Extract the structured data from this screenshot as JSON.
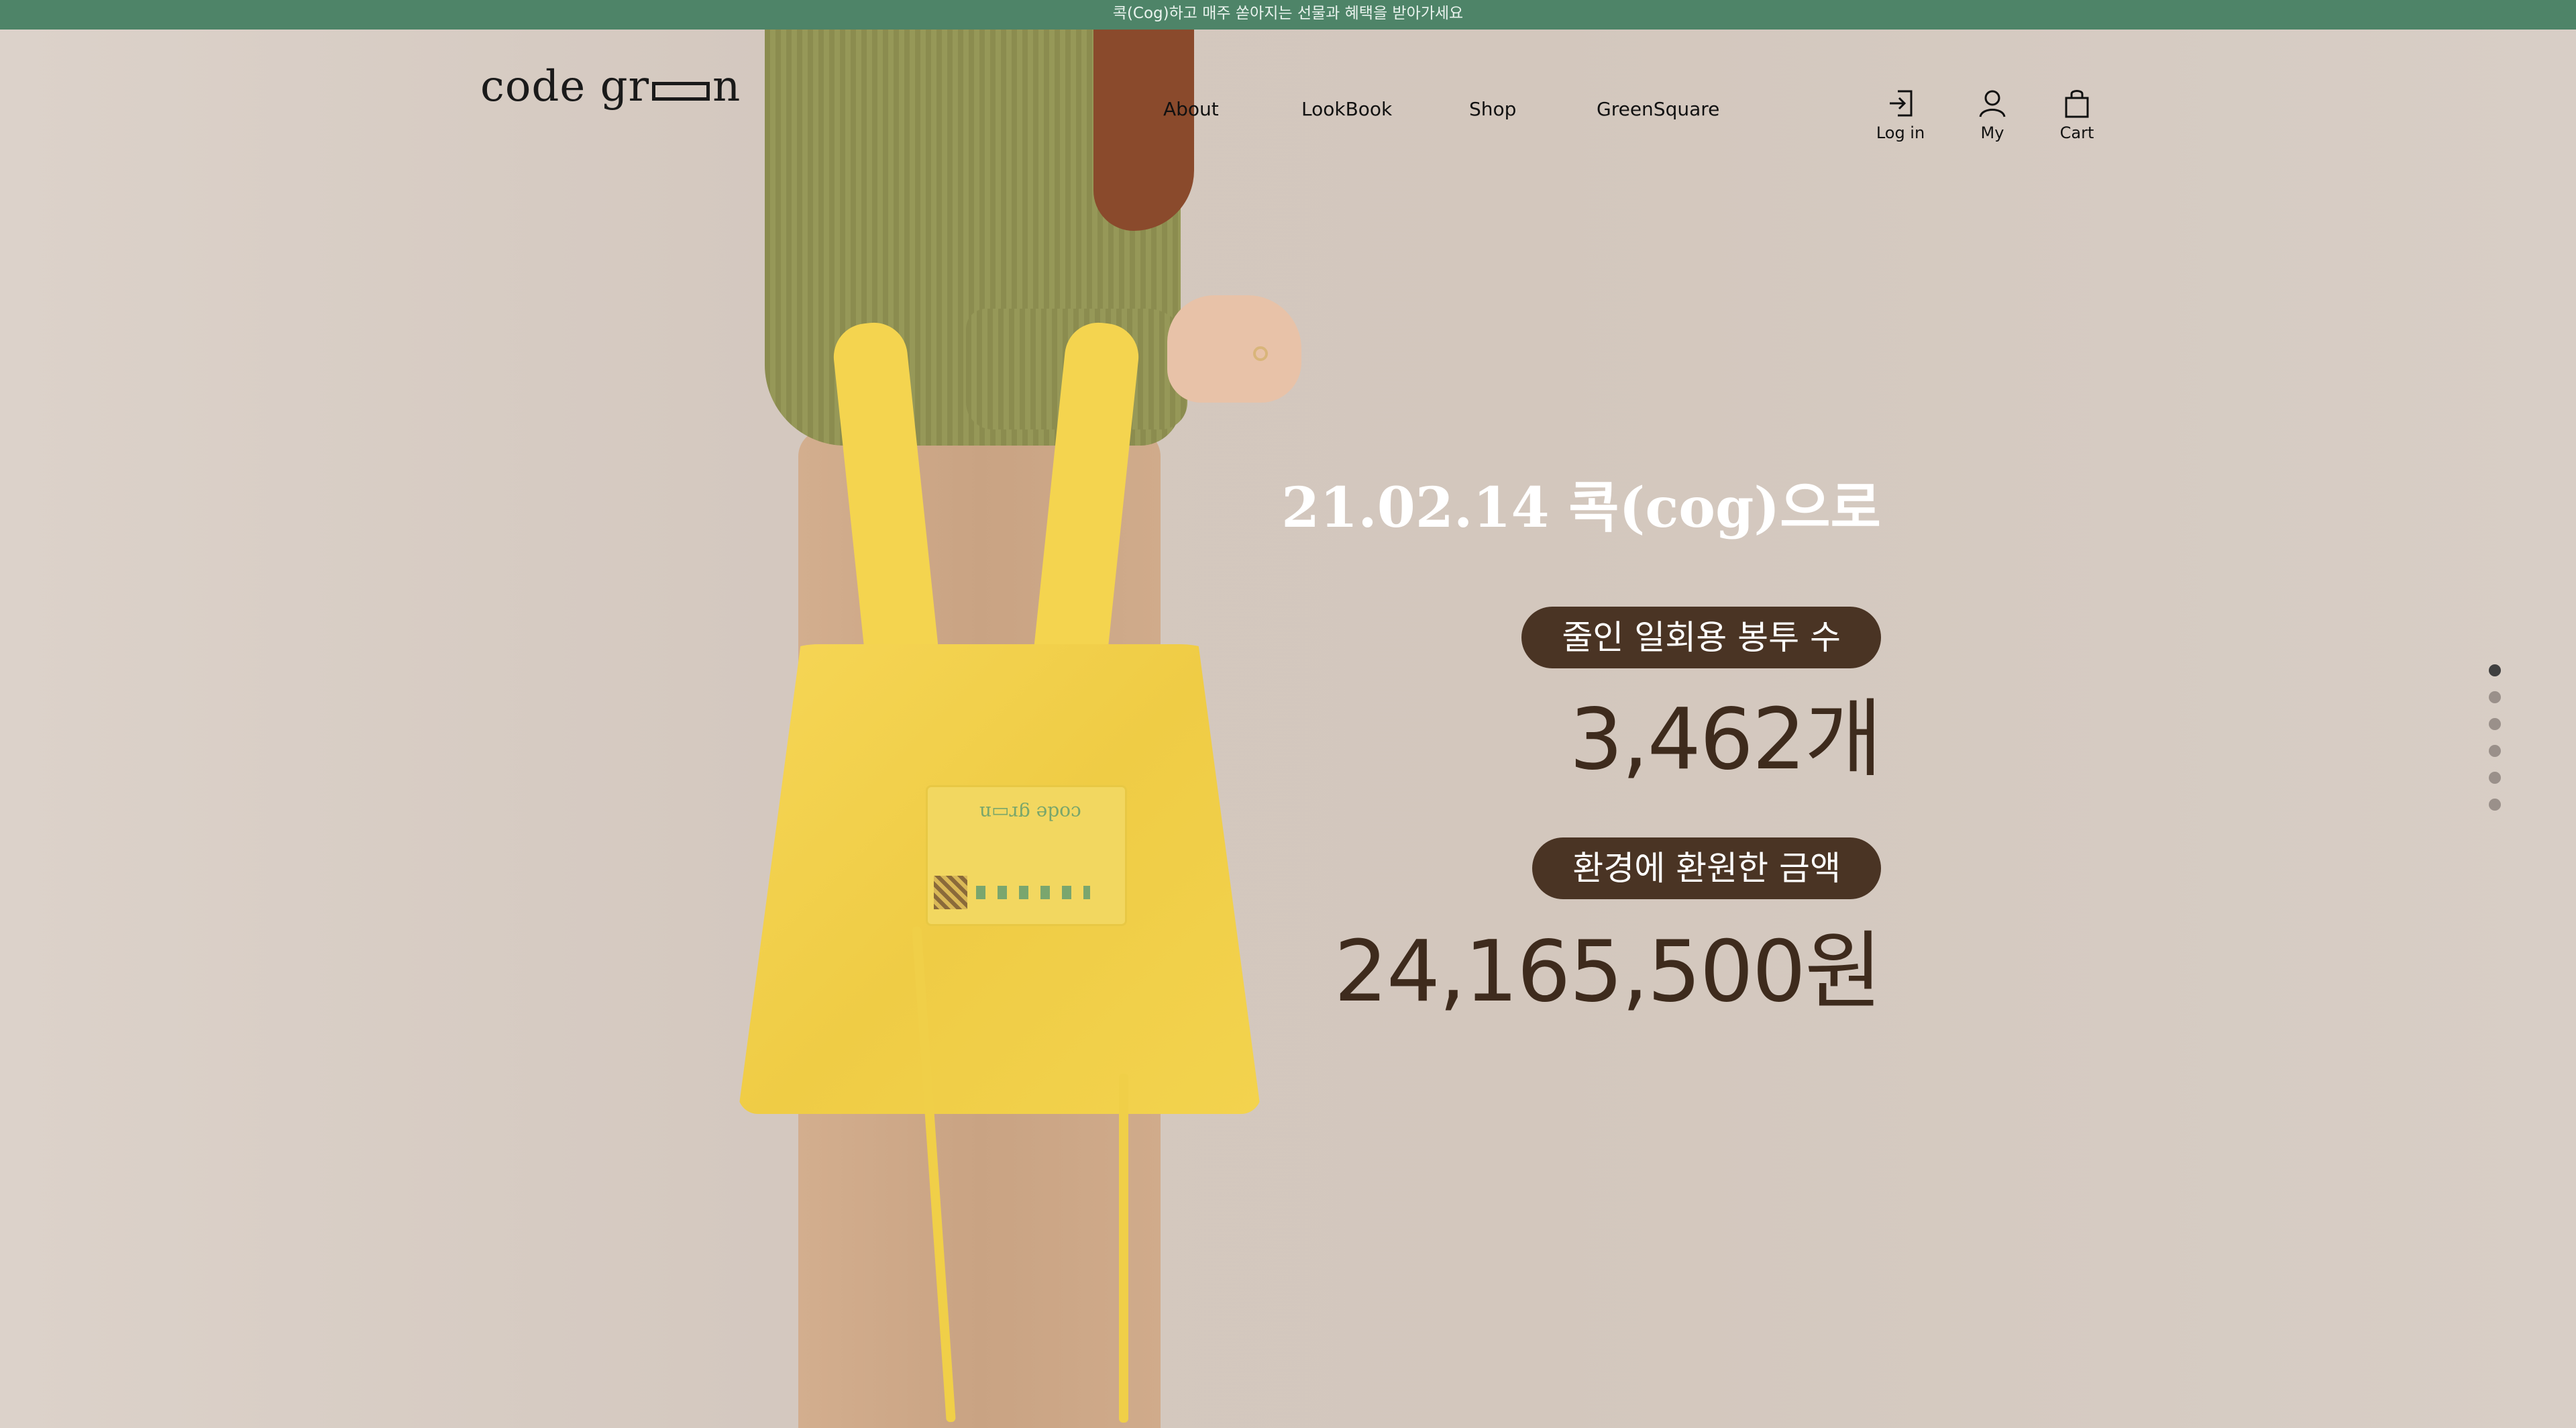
{
  "announcement": "콕(Cog)하고 매주 쏟아지는 선물과 혜택을 받아가세요",
  "brand": {
    "logo_part1": "code gr",
    "logo_part2": "n"
  },
  "nav": {
    "items": [
      {
        "label": "About"
      },
      {
        "label": "LookBook"
      },
      {
        "label": "Shop"
      },
      {
        "label": "GreenSquare"
      }
    ]
  },
  "utility": {
    "login": "Log in",
    "my": "My",
    "cart": "Cart"
  },
  "hero": {
    "headline": "21.02.14 콕(cog)으로",
    "stat1_label": "줄인 일회용 봉투 수",
    "stat1_value": "3,462개",
    "stat2_label": "환경에 환원한 금액",
    "stat2_value": "24,165,500원"
  },
  "pagination": {
    "total": 6,
    "active": 1
  },
  "colors": {
    "announcement_bg": "#4e8468",
    "pill_bg": "#4a3424",
    "value_text": "#3e2b1d",
    "bag": "#f4d44f"
  }
}
